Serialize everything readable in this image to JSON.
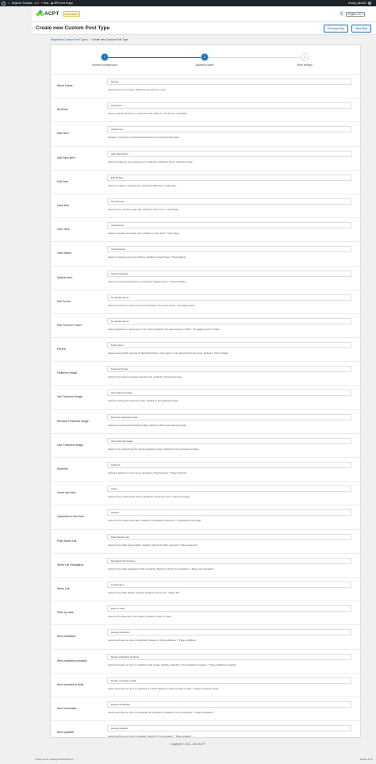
{
  "admin_bar": {
    "site_name": "Beginner Tutorials",
    "comments_count": "0",
    "new_label": "+ New",
    "plugin_label": "WPForms Plugin",
    "howdy": "Howdy, plikes03"
  },
  "header": {
    "logo_text": "ACPT",
    "version": "2.0.9-beta-3",
    "language": "English US"
  },
  "page": {
    "title": "Create new Custom Post Type",
    "previous_button": "Previous Step",
    "next_button": "Next Step"
  },
  "breadcrumb": {
    "parent": "Registered Custom Post Types",
    "separator": "/",
    "current": "Create new Custom Post Type"
  },
  "stepper": [
    {
      "number": "1",
      "label": "Minimum configuration",
      "state": "active"
    },
    {
      "number": "2",
      "label": "Additional labels",
      "state": "active"
    },
    {
      "number": "3",
      "label": "Other settings",
      "state": "inactive"
    }
  ],
  "fields": [
    {
      "label": "Menu Name",
      "value": "Recipe",
      "help": "Label for the menu name. Default is the same as name."
    },
    {
      "label": "All Items",
      "value": "All Recipe",
      "help": "Label to signify all items in a submenu link. Default is 'All Posts' / 'All Pages'."
    },
    {
      "label": "Add New",
      "value": "Add Recipe",
      "help": "Default is 'Add New' for both hierarchical and non-hierarchical types."
    },
    {
      "label": "Add New Item",
      "value": "Add new Recipe",
      "help": "Label for adding a new singular item. Default is 'Add New Post' / 'Add New Page'."
    },
    {
      "label": "Edit Item",
      "value": "Edit Recipe",
      "help": "Label for editing a singular item. Default is 'Edit Post' / 'Edit Page'."
    },
    {
      "label": "New Item",
      "value": "New Recipe",
      "help": "Label for the new item page title. Default is 'New Post' / 'New Page'."
    },
    {
      "label": "View Item",
      "value": "View Recipe",
      "help": "Label for viewing a singular item. Default is 'View Post' / 'View Page'."
    },
    {
      "label": "View Items",
      "value": "View Recipes",
      "help": "Label for viewing post type archives. Default is 'View Posts' / 'View Pages'."
    },
    {
      "label": "Search Item",
      "value": "Search Recipes",
      "help": "Label for searching plural items. Default is 'Search Posts' / 'Search Pages'."
    },
    {
      "label": "Not Found",
      "value": "No Recipe found",
      "help": "Label used when no items are found. Default is 'No posts found' / 'No pages found'."
    },
    {
      "label": "Not Found in Trash",
      "value": "No Recipe found",
      "help": "Label used when no items are in the Trash. Default is 'No posts found in Trash' / 'No pages found in Trash'."
    },
    {
      "label": "Parent",
      "value": "Parent Item",
      "help": "Label used to prefix parents of hierarchical items. Not used on non-hierarchical post types. Default is 'Parent Page:'."
    },
    {
      "label": "Featured Image",
      "value": "Featured Image",
      "help": "Label for the featured image meta box title. Default is 'Featured Image'."
    },
    {
      "label": "Set Featured Image",
      "value": "Set Featured Image",
      "help": "Label for setting the featured image. Default is 'Set featured image'."
    },
    {
      "label": "Remove Featured Image",
      "value": "Remove Featured Image",
      "help": "Label for removing the featured image. Default is 'Remove featured image'."
    },
    {
      "label": "Use Featured Image",
      "value": "Use Featured Image",
      "help": "Label in the media frame for using a featured image. Default is 'Use as featured image'."
    },
    {
      "label": "Archives",
      "value": "Archives",
      "help": "Label for archives in nav menus. Default is 'Post Archives' / 'Page Archives'."
    },
    {
      "label": "Insert into item",
      "value": "Insert",
      "help": "Label for the media frame button. Default is 'Insert into post' / 'Insert into page'."
    },
    {
      "label": "Uploaded to this Item",
      "value": "Upload",
      "help": "Label for the media frame filter. Default is 'Uploaded to this post' / 'Uploaded to this page'."
    },
    {
      "label": "Filter Items List",
      "value": "Filter Recipes list",
      "help": "Label for the table views hidden heading. Default is 'Filter posts list' / 'Filter pages list'."
    },
    {
      "label": "Items List Navigation",
      "value": "Navigation list Recipes",
      "help": "Label for the table pagination hidden heading. Default is 'Posts list navigation' / 'Pages list navigation'."
    },
    {
      "label": "Items List",
      "value": "List Recipes",
      "help": "Label for the table hidden heading. Default is 'Posts list' / 'Pages list'."
    },
    {
      "label": "Filter by date",
      "value": "Filter by date",
      "help": "Label for the date filter in list tables. Default is 'Filter by date'."
    },
    {
      "label": "Item published",
      "value": "Recipe published",
      "help": "Label used when an item is published. Default is 'Post published.' / 'Page published.'"
    },
    {
      "label": "Item published privately",
      "value": "Recipe published privately",
      "help": "Label used when an item is published with private visibility. Default is 'Post published privately.' / 'Page published privately.'"
    },
    {
      "label": "Item reverted to draft",
      "value": "Recipe reverted to draft",
      "help": "Label used when an item is switched to a draft. Default is 'Post reverted to draft.' / 'Page reverted to draft.'"
    },
    {
      "label": "Item scheduled",
      "value": "Recipe scheduled",
      "help": "Label used when an item is scheduled for publishing. Default is 'Post scheduled.' / 'Page scheduled.'"
    },
    {
      "label": "Item updated",
      "value": "Recipe updated",
      "help": "Label used when an item is updated. Default is 'Post updated.' / 'Page updated.'"
    }
  ],
  "footer": {
    "copyright": "Copyright © 2021 - 2024",
    "brand": "ACPT",
    "thanks_prefix": "Thank you for creating with",
    "thanks_link": "WordPress",
    "wp_version": "Version 6.5.2"
  }
}
